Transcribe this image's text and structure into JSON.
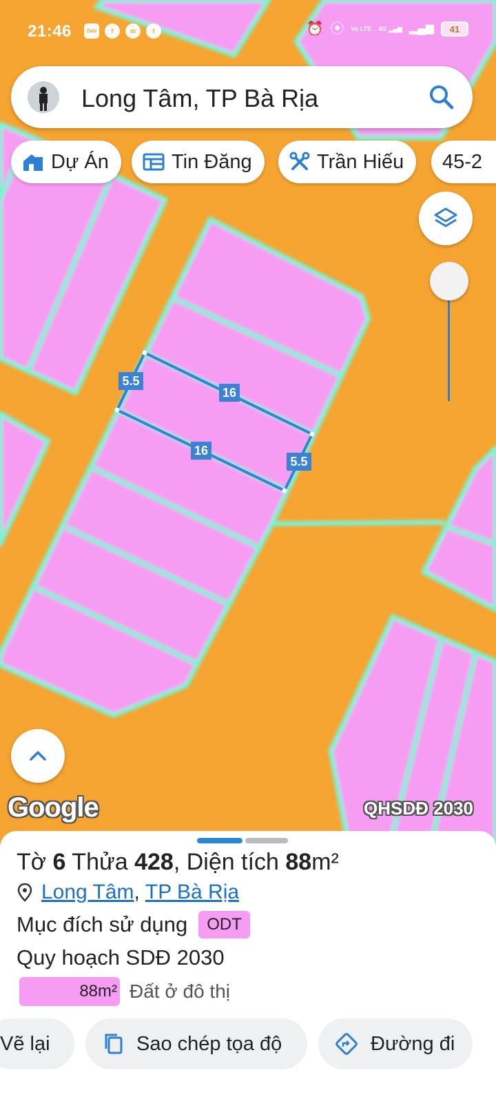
{
  "status_bar": {
    "time": "21:46",
    "apps": [
      "Zalo",
      "f",
      "m",
      "f"
    ],
    "network": "Vo LTE",
    "signal": "4G",
    "battery": "41"
  },
  "search": {
    "text": "Long Tâm, TP Bà Rịa",
    "icon": "search-icon"
  },
  "chips": [
    {
      "label": "Dự Án",
      "icon": "building-icon"
    },
    {
      "label": "Tin Đăng",
      "icon": "listing-icon"
    },
    {
      "label": "Trần Hiếu",
      "icon": "tools-icon"
    },
    {
      "label": "45-2"
    }
  ],
  "map": {
    "parcel_dimensions": {
      "top": "16",
      "bottom": "16",
      "left": "5.5",
      "right": "5.5"
    },
    "logo": "Google",
    "layer_label": "QHSDĐ 2030",
    "colors": {
      "land": "#f79cf3",
      "road": "#f6a431",
      "border": "#7cf3d5",
      "selection": "#2d86d4"
    }
  },
  "sheet": {
    "parcel": {
      "to_label": "Tờ",
      "to_value": "6",
      "thua_label": "Thửa",
      "thua_value": "428",
      "area_label": "Diện tích",
      "area_value": "88",
      "area_unit": "m²"
    },
    "location": {
      "ward": "Long Tâm",
      "separator": ",",
      "city": "TP Bà Rịa"
    },
    "purpose_label": "Mục đích sử dụng",
    "purpose_code": "ODT",
    "plan_label": "Quy hoạch SDĐ 2030",
    "legend": {
      "area": "88m²",
      "description": "Đất ở đô thị"
    },
    "actions": [
      {
        "label": "Vẽ lại"
      },
      {
        "label": "Sao chép tọa độ",
        "icon": "copy-icon"
      },
      {
        "label": "Đường đi",
        "icon": "directions-icon"
      }
    ]
  }
}
